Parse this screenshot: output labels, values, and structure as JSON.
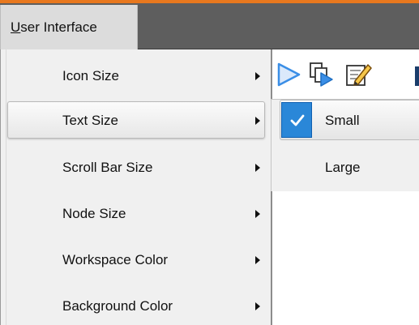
{
  "menubar": {
    "active_menu": {
      "label_rest": "ser Interface",
      "mnemonic": "U"
    }
  },
  "dropdown": {
    "items": [
      {
        "label": "Icon Size",
        "has_submenu": true
      },
      {
        "label": "Text Size",
        "has_submenu": true,
        "highlighted": true
      },
      {
        "label": "Scroll Bar Size",
        "has_submenu": true
      },
      {
        "label": "Node Size",
        "has_submenu": true
      },
      {
        "label": "Workspace Color",
        "has_submenu": true
      },
      {
        "label": "Background Color",
        "has_submenu": true
      }
    ]
  },
  "submenu": {
    "items": [
      {
        "label": "Small",
        "checked": true
      },
      {
        "label": "Large",
        "checked": false
      }
    ]
  },
  "toolbar": {
    "icons": [
      "play-icon",
      "run-pages-icon",
      "edit-note-icon",
      "partial-icon"
    ]
  },
  "colors": {
    "accent_top": "#e8781e",
    "menubar_bg": "#5e5e5e",
    "menu_bg": "#f0f0f0",
    "check_bg": "#2a87d8",
    "play_icon": "#3a8ee6"
  }
}
